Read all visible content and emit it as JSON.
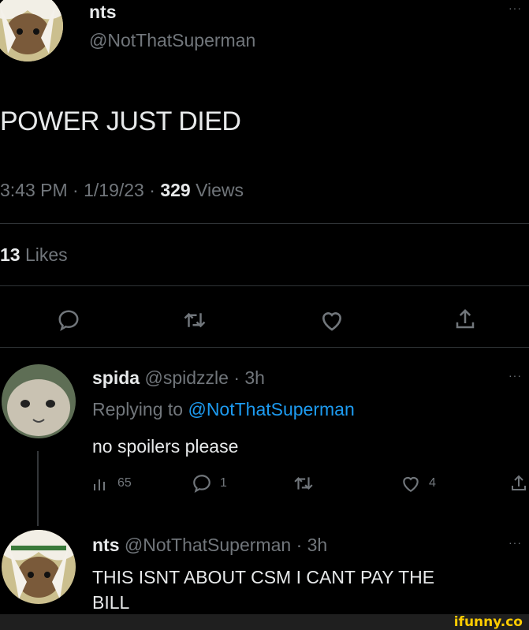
{
  "main_tweet": {
    "display_name": "nts",
    "handle": "@NotThatSuperman",
    "text": "POWER JUST DIED",
    "time": "3:43 PM",
    "date": "1/19/23",
    "views_count": "329",
    "views_label": "Views",
    "likes_count": "13",
    "likes_label": "Likes",
    "separator": "·"
  },
  "reply": {
    "display_name": "spida",
    "handle": "@spidzzle",
    "age": "· 3h",
    "replying_to_label": "Replying to",
    "replying_to_handle": "@NotThatSuperman",
    "text": "no spoilers please",
    "views": "65",
    "replies": "1",
    "likes": "4"
  },
  "reply2": {
    "display_name": "nts",
    "handle": "@NotThatSuperman",
    "age": "· 3h",
    "text_line1": "THIS ISNT ABOUT CSM I CANT PAY THE",
    "text_line2": "BILL"
  },
  "watermark": "ifunny.co",
  "icons": [
    "reply-icon",
    "retweet-icon",
    "like-icon",
    "share-icon",
    "views-icon",
    "more-icon"
  ],
  "colors": {
    "link": "#1d9bf0",
    "muted": "#71767b",
    "text": "#e7e9ea",
    "background": "#000000"
  }
}
